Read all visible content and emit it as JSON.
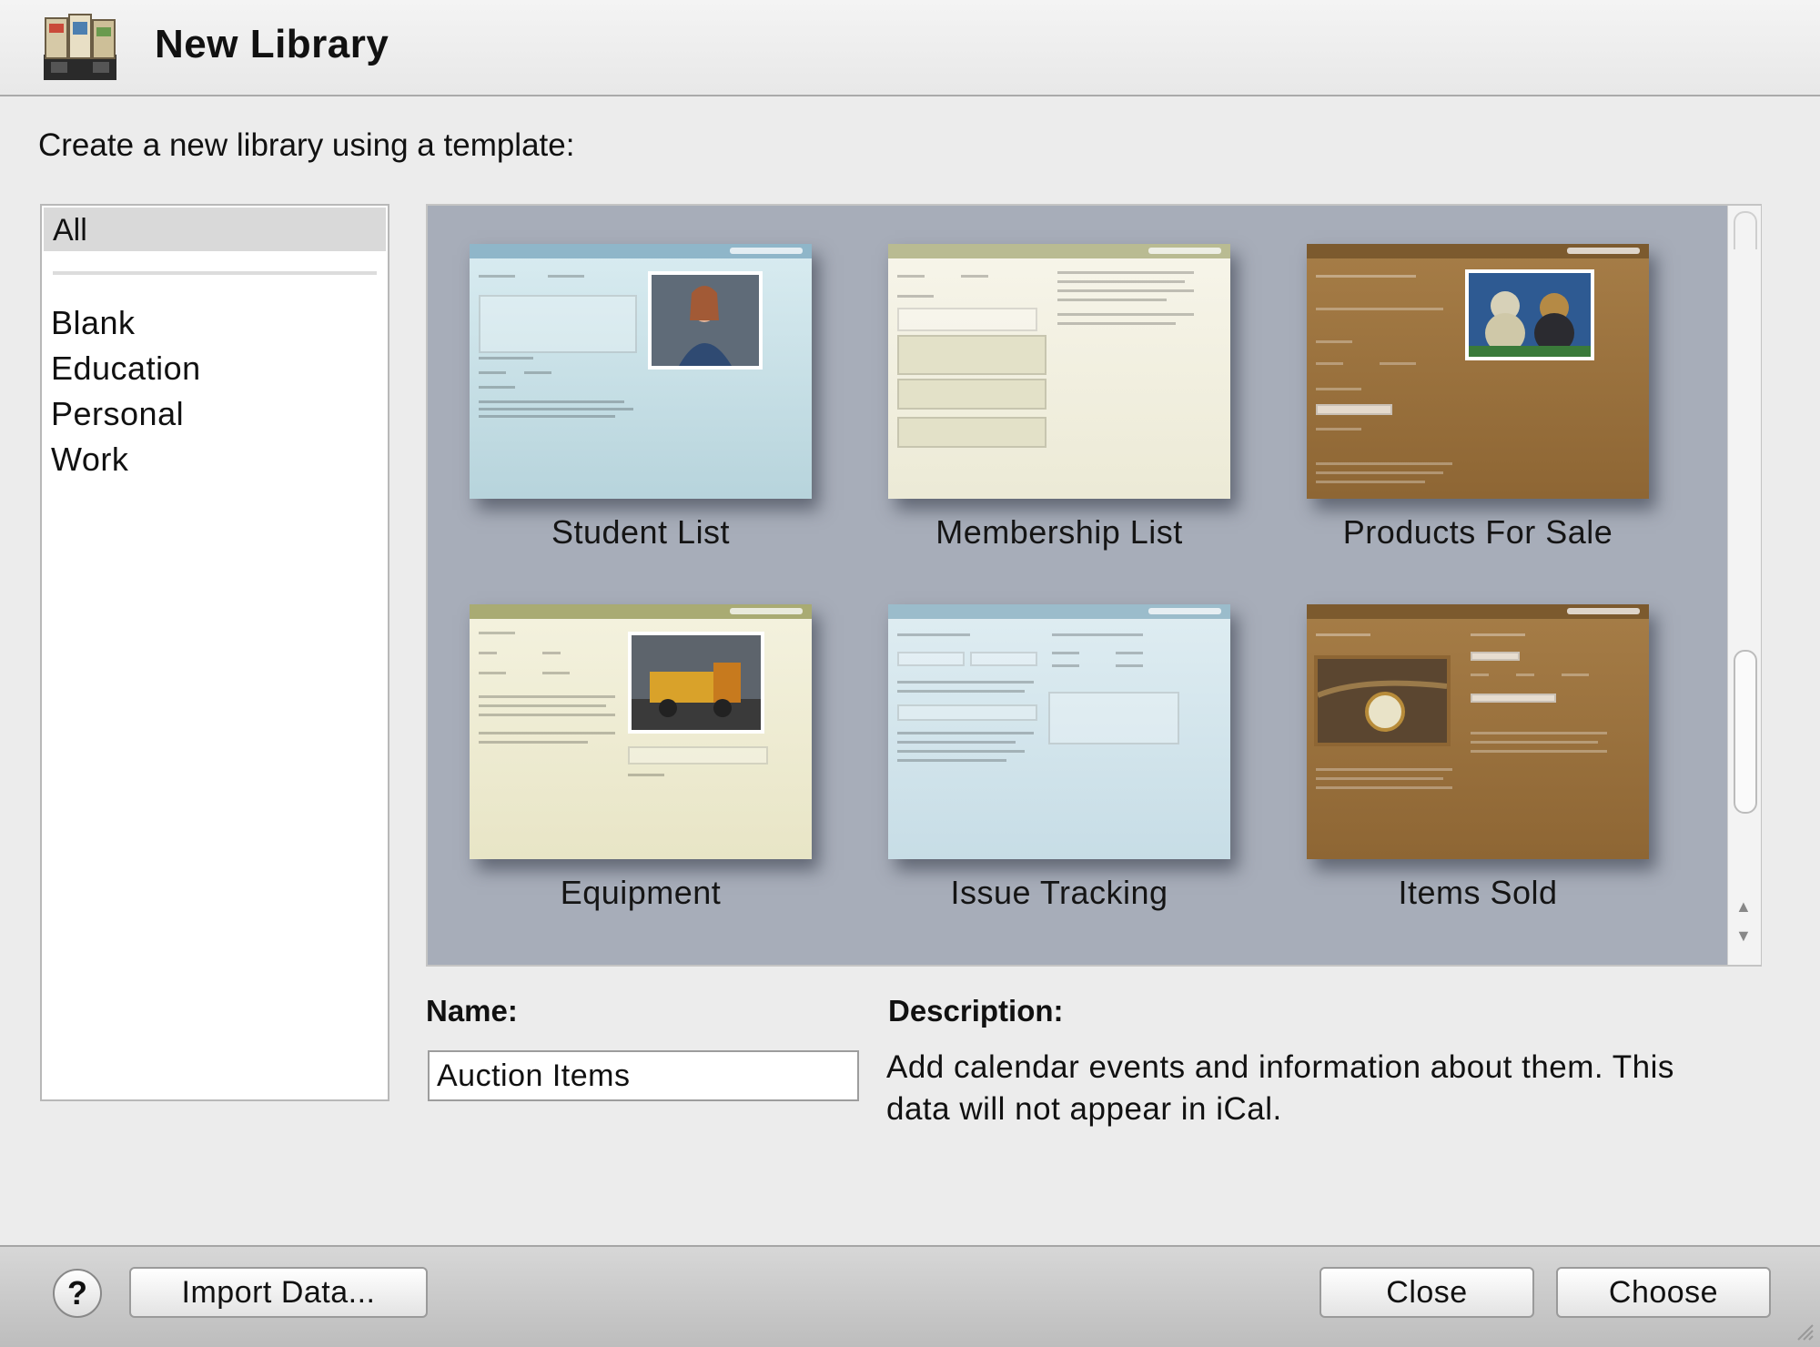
{
  "window": {
    "title": "New Library",
    "icon": "library-app-icon"
  },
  "prompt": "Create a new library using a template:",
  "categories": {
    "selected": "All",
    "items": [
      "Blank",
      "Education",
      "Personal",
      "Work"
    ]
  },
  "templates": [
    {
      "name": "Student List",
      "theme": "#c5dee5"
    },
    {
      "name": "Membership List",
      "theme": "#f1efe0"
    },
    {
      "name": "Products For Sale",
      "theme": "#9c7440"
    },
    {
      "name": "Equipment",
      "theme": "#efedd6"
    },
    {
      "name": "Issue Tracking",
      "theme": "#d2e3ea"
    },
    {
      "name": "Items Sold",
      "theme": "#9c7440"
    }
  ],
  "form": {
    "name_label": "Name:",
    "name_value": "Auction Items",
    "description_label": "Description:",
    "description_text": "Add calendar events and information about them. This data will not appear in iCal."
  },
  "footer": {
    "help_label": "?",
    "import_label": "Import Data...",
    "close_label": "Close",
    "choose_label": "Choose"
  },
  "colors": {
    "template_pane_bg": "#a7adb9",
    "selection_bg": "#d9d9d9"
  }
}
